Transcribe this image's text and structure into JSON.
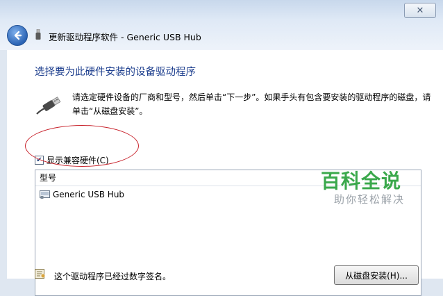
{
  "window": {
    "title": "更新驱动程序软件 - Generic USB Hub",
    "close_glyph": "✕"
  },
  "main": {
    "heading": "选择要为此硬件安装的设备驱动程序",
    "instruction": "请选定硬件设备的厂商和型号，然后单击“下一步”。如果手头有包含要安装的驱动程序的磁盘，请单击“从磁盘安装”。",
    "show_compatible": {
      "label": "显示兼容硬件(C)",
      "checked": true
    },
    "model_list": {
      "header": "型号",
      "items": [
        "Generic USB Hub"
      ]
    },
    "signature_text": "这个驱动程序已经过数字签名。",
    "have_disk_button": "从磁盘安装(H)..."
  },
  "watermark": {
    "title": "百科全说",
    "subtitle": "助你轻松解决"
  },
  "colors": {
    "heading": "#1e3f8e",
    "highlight_circle": "#c8232c",
    "watermark": "#3aa84b"
  }
}
